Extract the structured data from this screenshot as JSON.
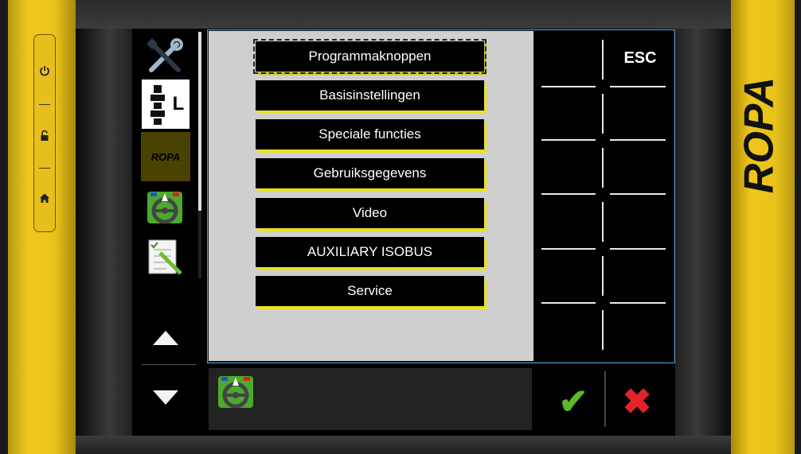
{
  "device": {
    "brand": "ROPA",
    "left_buttons": [
      {
        "name": "power-icon",
        "glyph": "⏻"
      },
      {
        "name": "unlock-icon",
        "glyph": "🔓"
      },
      {
        "name": "home-icon",
        "glyph": "🏠"
      }
    ]
  },
  "sidebar": {
    "items": [
      {
        "name": "tools-icon"
      },
      {
        "name": "machine-config-L",
        "label": "L"
      },
      {
        "name": "ropa-logo",
        "label": "ROPA"
      },
      {
        "name": "steering-wheel-icon"
      },
      {
        "name": "notepad-edit-icon"
      }
    ]
  },
  "menu": {
    "items": [
      {
        "label": "Programmaknoppen",
        "selected": true
      },
      {
        "label": "Basisinstellingen"
      },
      {
        "label": "Speciale functies"
      },
      {
        "label": "Gebruiksgegevens"
      },
      {
        "label": "Video"
      },
      {
        "label": "AUXILIARY ISOBUS"
      },
      {
        "label": "Service"
      }
    ]
  },
  "softkeys": {
    "esc_label": "ESC"
  },
  "footer": {
    "ok_glyph": "✔",
    "cancel_glyph": "✖"
  },
  "colors": {
    "brand_yellow": "#e8c21a",
    "button_shadow_yellow": "#e9e220",
    "screen_border": "#5aa4d6",
    "ok_green": "#5fb82a",
    "cancel_red": "#e0242a"
  }
}
